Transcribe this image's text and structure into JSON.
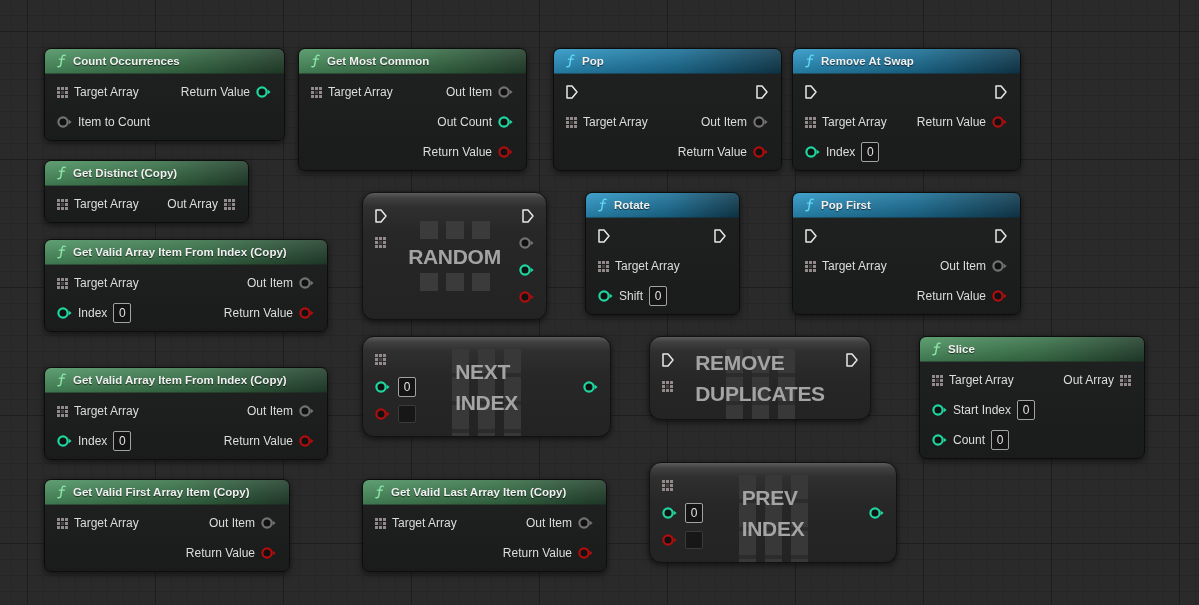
{
  "graph": {
    "nodes": [
      {
        "kind": "pure",
        "title": "Count Occurrences",
        "rows": [
          {
            "left": {
              "kind": "array",
              "label": "Target Array"
            },
            "right": {
              "kind": "int",
              "label": "Return Value"
            }
          },
          {
            "left": {
              "kind": "wildcard",
              "label": "Item to Count"
            }
          }
        ]
      },
      {
        "kind": "pure",
        "title": "Get Most Common",
        "rows": [
          {
            "left": {
              "kind": "array",
              "label": "Target Array"
            },
            "right": {
              "kind": "wildcard",
              "label": "Out Item"
            }
          },
          {
            "right": {
              "kind": "int",
              "label": "Out Count"
            }
          },
          {
            "right": {
              "kind": "bool",
              "label": "Return Value"
            }
          }
        ]
      },
      {
        "kind": "impure",
        "title": "Pop",
        "rows": [
          {
            "left": {
              "kind": "exec"
            },
            "right": {
              "kind": "exec"
            }
          },
          {
            "left": {
              "kind": "array",
              "label": "Target Array"
            },
            "right": {
              "kind": "wildcard",
              "label": "Out Item"
            }
          },
          {
            "right": {
              "kind": "bool",
              "label": "Return Value"
            }
          }
        ]
      },
      {
        "kind": "impure",
        "title": "Remove At Swap",
        "rows": [
          {
            "left": {
              "kind": "exec"
            },
            "right": {
              "kind": "exec"
            }
          },
          {
            "left": {
              "kind": "array",
              "label": "Target Array"
            },
            "right": {
              "kind": "bool",
              "label": "Return Value"
            }
          },
          {
            "left": {
              "kind": "int",
              "label": "Index",
              "value": "0"
            }
          }
        ]
      },
      {
        "kind": "pure",
        "title": "Get Distinct (Copy)",
        "rows": [
          {
            "left": {
              "kind": "array",
              "label": "Target Array"
            },
            "right": {
              "kind": "array",
              "label": "Out Array"
            }
          }
        ]
      },
      {
        "kind": "pure",
        "title": "Get Valid Array Item From Index (Copy)",
        "rows": [
          {
            "left": {
              "kind": "array",
              "label": "Target Array"
            },
            "right": {
              "kind": "wildcard",
              "label": "Out Item"
            }
          },
          {
            "left": {
              "kind": "int",
              "label": "Index",
              "value": "0"
            },
            "right": {
              "kind": "bool",
              "label": "Return Value"
            }
          }
        ]
      },
      {
        "kind": "compact",
        "title": "RANDOM",
        "symbol": {
          "kind": "squares"
        },
        "inputs": [
          {
            "kind": "exec"
          },
          {
            "kind": "array"
          }
        ],
        "outputs": [
          {
            "kind": "exec"
          },
          {
            "kind": "wildcard"
          },
          {
            "kind": "int"
          },
          {
            "kind": "bool"
          }
        ]
      },
      {
        "kind": "impure",
        "title": "Rotate",
        "rows": [
          {
            "left": {
              "kind": "exec"
            },
            "right": {
              "kind": "exec"
            }
          },
          {
            "left": {
              "kind": "array",
              "label": "Target Array"
            }
          },
          {
            "left": {
              "kind": "int",
              "label": "Shift",
              "value": "0"
            }
          }
        ]
      },
      {
        "kind": "impure",
        "title": "Pop First",
        "rows": [
          {
            "left": {
              "kind": "exec"
            },
            "right": {
              "kind": "exec"
            }
          },
          {
            "left": {
              "kind": "array",
              "label": "Target Array"
            },
            "right": {
              "kind": "wildcard",
              "label": "Out Item"
            }
          },
          {
            "right": {
              "kind": "bool",
              "label": "Return Value"
            }
          }
        ]
      },
      {
        "kind": "pure",
        "title": "Get Valid Array Item From Index (Copy)",
        "rows": [
          {
            "left": {
              "kind": "array",
              "label": "Target Array"
            },
            "right": {
              "kind": "wildcard",
              "label": "Out Item"
            }
          },
          {
            "left": {
              "kind": "int",
              "label": "Index",
              "value": "0"
            },
            "right": {
              "kind": "bool",
              "label": "Return Value"
            }
          }
        ]
      },
      {
        "kind": "compact",
        "title": "NEXT INDEX",
        "symbol": {
          "kind": "columns"
        },
        "inputs": [
          {
            "kind": "array"
          },
          {
            "kind": "int",
            "value": "0"
          },
          {
            "kind": "bool",
            "checked": false
          }
        ],
        "outputs": [
          {
            "kind": "int"
          }
        ]
      },
      {
        "kind": "compact",
        "title": "REMOVE DUPLICATES",
        "symbol": {
          "kind": "columns"
        },
        "inputs": [
          {
            "kind": "exec"
          },
          {
            "kind": "array"
          }
        ],
        "outputs": [
          {
            "kind": "exec"
          }
        ]
      },
      {
        "kind": "pure",
        "title": "Slice",
        "rows": [
          {
            "left": {
              "kind": "array",
              "label": "Target Array"
            },
            "right": {
              "kind": "array",
              "label": "Out Array"
            }
          },
          {
            "left": {
              "kind": "int",
              "label": "Start Index",
              "value": "0"
            }
          },
          {
            "left": {
              "kind": "int",
              "label": "Count",
              "value": "0"
            }
          }
        ]
      },
      {
        "kind": "pure",
        "title": "Get Valid First Array Item (Copy)",
        "rows": [
          {
            "left": {
              "kind": "array",
              "label": "Target Array"
            },
            "right": {
              "kind": "wildcard",
              "label": "Out Item"
            }
          },
          {
            "right": {
              "kind": "bool",
              "label": "Return Value"
            }
          }
        ]
      },
      {
        "kind": "pure",
        "title": "Get Valid Last Array Item (Copy)",
        "rows": [
          {
            "left": {
              "kind": "array",
              "label": "Target Array"
            },
            "right": {
              "kind": "wildcard",
              "label": "Out Item"
            }
          },
          {
            "right": {
              "kind": "bool",
              "label": "Return Value"
            }
          }
        ]
      },
      {
        "kind": "compact",
        "title": "PREV INDEX",
        "symbol": {
          "kind": "columns"
        },
        "inputs": [
          {
            "kind": "array"
          },
          {
            "kind": "int",
            "value": "0"
          },
          {
            "kind": "bool",
            "checked": false
          }
        ],
        "outputs": [
          {
            "kind": "int"
          }
        ]
      }
    ]
  }
}
